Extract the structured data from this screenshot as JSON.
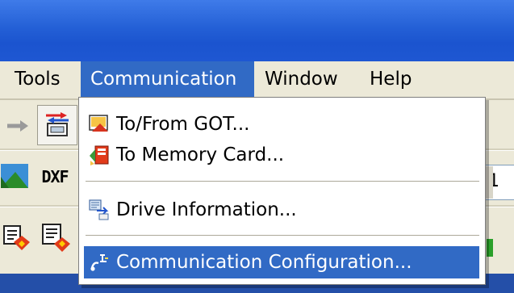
{
  "menubar": {
    "items": [
      {
        "label": "Tools"
      },
      {
        "label": "Communication"
      },
      {
        "label": "Window"
      },
      {
        "label": "Help"
      }
    ]
  },
  "communication_menu": {
    "items": [
      {
        "label": "To/From GOT...",
        "icon": "got-transfer-icon"
      },
      {
        "label": "To Memory Card...",
        "icon": "memory-card-icon"
      },
      {
        "label": "Drive Information...",
        "icon": "drive-info-icon"
      },
      {
        "label": "Communication Configuration...",
        "icon": "comm-config-icon"
      }
    ],
    "highlighted": "Communication Configuration..."
  },
  "toolbar": {
    "dxf_label": "DXF",
    "field_value": "1"
  },
  "colors": {
    "title_blue": "#2460d6",
    "highlight": "#316ac5",
    "face": "#ece9d8"
  }
}
